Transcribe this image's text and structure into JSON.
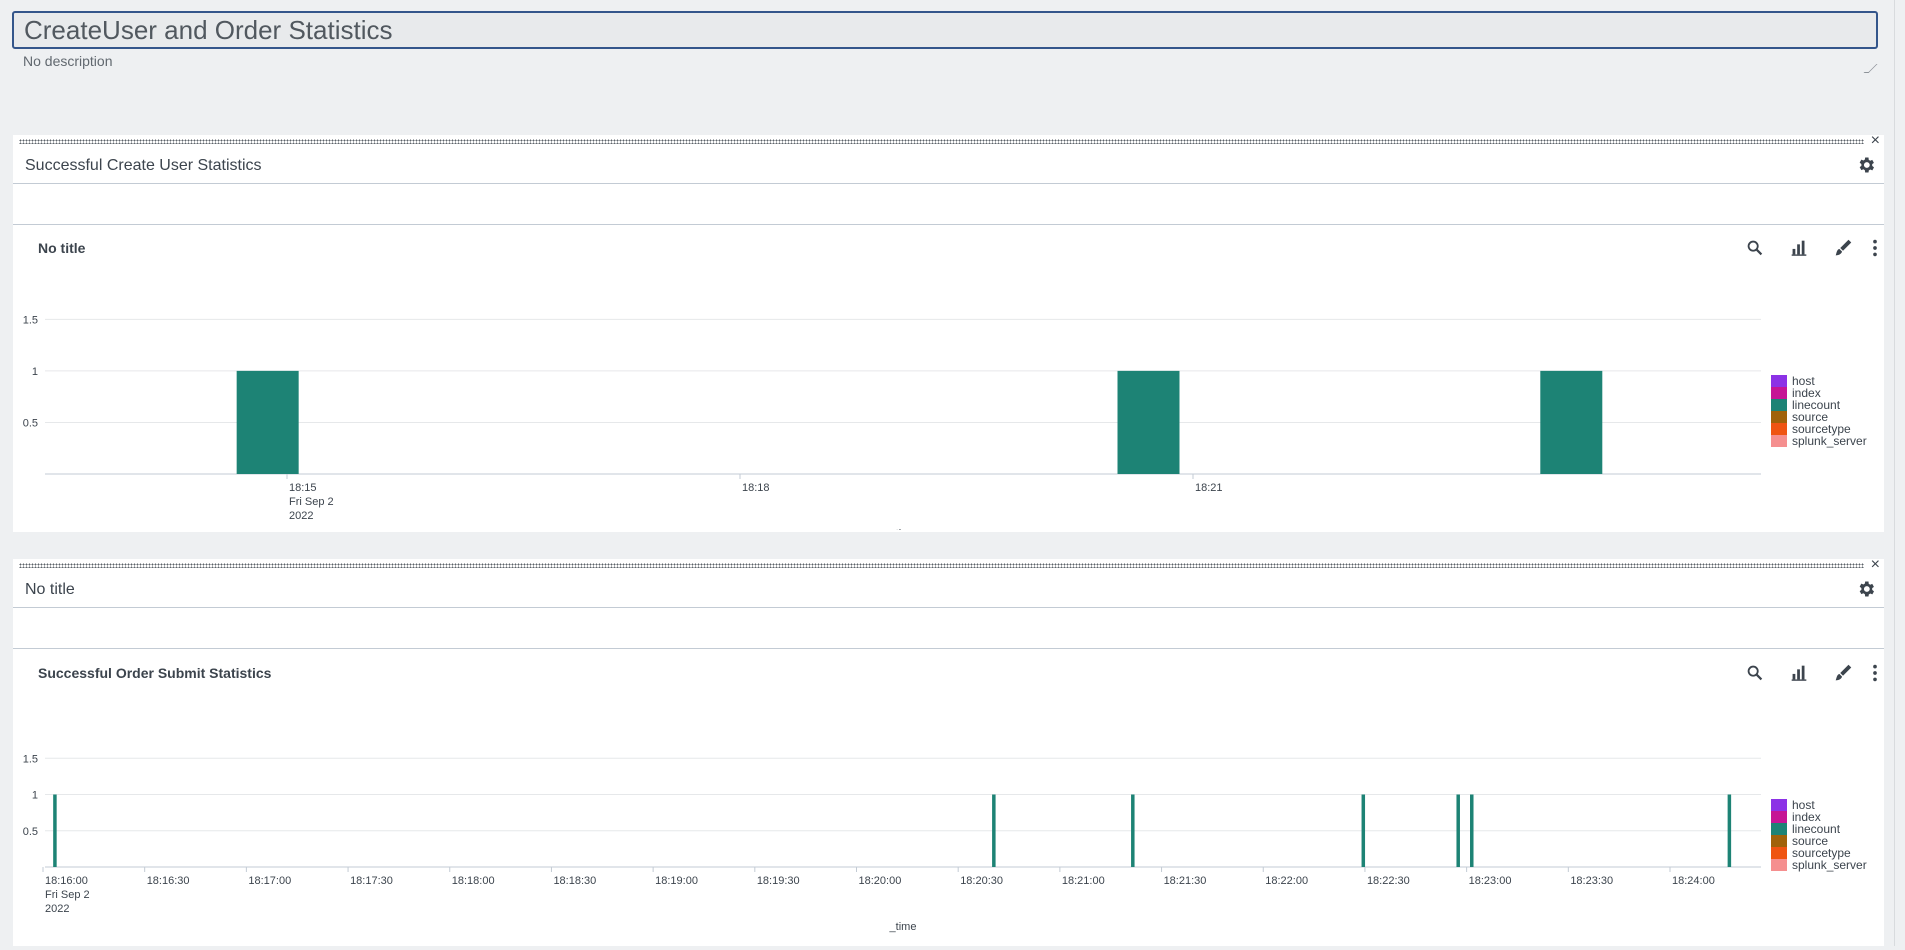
{
  "dashboard": {
    "title": "CreateUser and Order Statistics",
    "description": "No description"
  },
  "icons": {
    "close": "close-icon",
    "gear": "gear-icon",
    "search": "search-icon",
    "chart": "bar-chart-icon",
    "edit": "paintbrush-icon",
    "more": "more-vertical-icon"
  },
  "colors": {
    "bar": "#1d8375",
    "title_border": "#34568b"
  },
  "panels": [
    {
      "header_title": "Successful Create User Statistics",
      "viz_title": "No title",
      "close_symbol": "×"
    },
    {
      "header_title": "No title",
      "viz_title": "Successful Order Submit Statistics",
      "close_symbol": "×"
    }
  ],
  "legend": [
    {
      "name": "host",
      "color": "#8c32e6"
    },
    {
      "name": "index",
      "color": "#c61595"
    },
    {
      "name": "linecount",
      "color": "#1d8375"
    },
    {
      "name": "source",
      "color": "#a0620a"
    },
    {
      "name": "sourcetype",
      "color": "#ef5412"
    },
    {
      "name": "splunk_server",
      "color": "#f58f8f"
    }
  ],
  "chart_data": [
    {
      "type": "bar",
      "title": "No title",
      "xlabel": "_time",
      "ylabel": "",
      "ylim": [
        0,
        1.6
      ],
      "yticks": [
        "1.5",
        "1",
        "0.5"
      ],
      "xticks": [
        {
          "label": "18:15",
          "sub": [
            "Fri Sep 2",
            "2022"
          ]
        },
        {
          "label": "18:18"
        },
        {
          "label": "18:21"
        }
      ],
      "x_minutes_range": [
        18.0,
        29.4
      ],
      "bars": [
        {
          "t": "18:14:40",
          "series": "linecount",
          "value": 1
        },
        {
          "t": "18:20:30",
          "series": "linecount",
          "value": 1
        },
        {
          "t": "18:23:18",
          "series": "linecount",
          "value": 1
        }
      ]
    },
    {
      "type": "bar",
      "title": "Successful Order Submit Statistics",
      "xlabel": "_time",
      "ylabel": "",
      "ylim": [
        0,
        1.6
      ],
      "yticks": [
        "1.5",
        "1",
        "0.5"
      ],
      "xticks": [
        {
          "label": "18:16:00",
          "sub": [
            "Fri Sep 2",
            "2022"
          ]
        },
        {
          "label": "18:16:30"
        },
        {
          "label": "18:17:00"
        },
        {
          "label": "18:17:30"
        },
        {
          "label": "18:18:00"
        },
        {
          "label": "18:18:30"
        },
        {
          "label": "18:19:00"
        },
        {
          "label": "18:19:30"
        },
        {
          "label": "18:20:00"
        },
        {
          "label": "18:20:30"
        },
        {
          "label": "18:21:00"
        },
        {
          "label": "18:21:30"
        },
        {
          "label": "18:22:00"
        },
        {
          "label": "18:22:30"
        },
        {
          "label": "18:23:00"
        },
        {
          "label": "18:23:30"
        },
        {
          "label": "18:24:00"
        }
      ],
      "bars": [
        {
          "t": "18:16:03",
          "series": "linecount",
          "value": 1
        },
        {
          "t": "18:20:40",
          "series": "linecount",
          "value": 1
        },
        {
          "t": "18:21:21",
          "series": "linecount",
          "value": 1
        },
        {
          "t": "18:22:29",
          "series": "linecount",
          "value": 1
        },
        {
          "t": "18:22:57",
          "series": "linecount",
          "value": 1
        },
        {
          "t": "18:23:01",
          "series": "linecount",
          "value": 1
        },
        {
          "t": "18:24:17",
          "series": "linecount",
          "value": 1
        }
      ]
    }
  ]
}
